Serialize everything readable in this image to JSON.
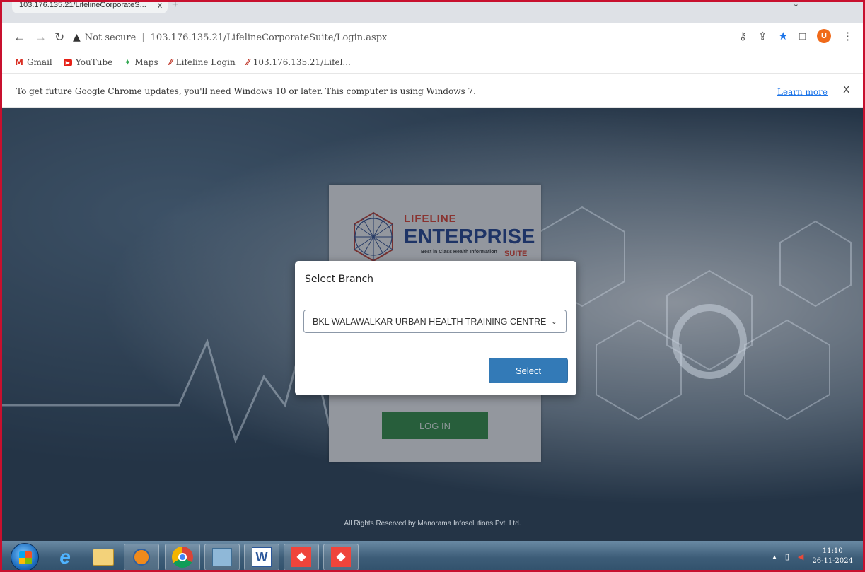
{
  "browser": {
    "tab_title": "103.176.135.21/LifelineCorporateS...",
    "tab_close": "x",
    "new_tab": "+",
    "security_label": "Not secure",
    "url": "103.176.135.21/LifelineCorporateSuite/Login.aspx",
    "profile_initial": "U"
  },
  "bookmarks": [
    {
      "label": "Gmail",
      "icon": "gmail-icon"
    },
    {
      "label": "YouTube",
      "icon": "youtube-icon"
    },
    {
      "label": "Maps",
      "icon": "maps-icon"
    },
    {
      "label": "Lifeline Login",
      "icon": "lifeline-icon"
    },
    {
      "label": "103.176.135.21/Lifel...",
      "icon": "lifeline-icon"
    }
  ],
  "infobar": {
    "message": "To get future Google Chrome updates, you'll need Windows 10 or later. This computer is using Windows 7.",
    "learn_more": "Learn more",
    "close": "X"
  },
  "login_card": {
    "brand_line1": "LIFELINE",
    "brand_line2": "ENTERPRISE",
    "tagline": "Best in Class Health Information",
    "brand_suite": "SUITE",
    "login_button": "LOG IN"
  },
  "footer": "All Rights Reserved by Manorama Infosolutions Pvt. Ltd.",
  "modal": {
    "title": "Select Branch",
    "selected_branch": "BKL WALAWALKAR URBAN HEALTH TRAINING CENTRE",
    "select_button": "Select"
  },
  "taskbar": {
    "time": "11:10",
    "date": "26-11-2024",
    "apps": [
      "internet-explorer-icon",
      "file-explorer-icon",
      "media-player-icon",
      "chrome-icon",
      "control-panel-icon",
      "word-icon",
      "anydesk-icon",
      "anydesk-icon"
    ]
  },
  "colors": {
    "frame_border": "#c8102e",
    "select_button": "#337ab7",
    "login_button": "#2e8b3e",
    "brand_red": "#e03c2a",
    "brand_blue": "#1e3e8c"
  }
}
